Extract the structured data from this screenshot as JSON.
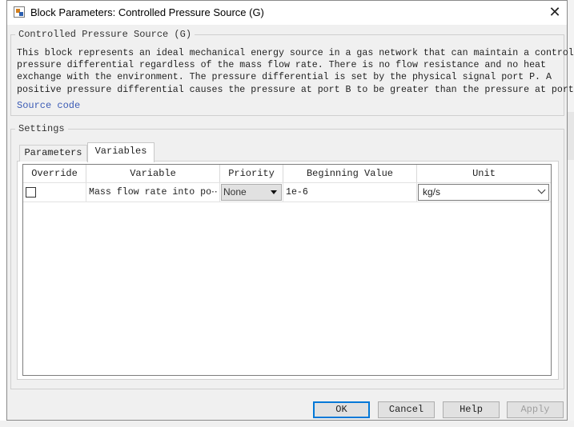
{
  "window": {
    "title": "Block Parameters: Controlled Pressure Source (G)",
    "close_symbol": "✕"
  },
  "block": {
    "group_title": "Controlled Pressure Source (G)",
    "description_lines": [
      "This block represents an ideal mechanical energy source in a gas network that can maintain a controlled",
      "pressure differential regardless of the mass flow rate. There is no flow resistance and no heat",
      "exchange with the environment. The pressure differential is set by the physical signal port P. A",
      "positive pressure differential causes the pressure at port B to be greater than the pressure at port A."
    ],
    "source_code_link": "Source code"
  },
  "settings": {
    "group_title": "Settings",
    "tabs": [
      {
        "label": "Parameters",
        "selected": false
      },
      {
        "label": "Variables",
        "selected": true
      }
    ]
  },
  "variables_table": {
    "columns": [
      "Override",
      "Variable",
      "Priority",
      "Beginning Value",
      "Unit"
    ],
    "rows": [
      {
        "override": false,
        "variable": "Mass flow rate into po⋯",
        "priority": "None",
        "beginning_value": "1e-6",
        "unit": "kg/s"
      }
    ]
  },
  "buttons": {
    "ok": "OK",
    "cancel": "Cancel",
    "help": "Help",
    "apply": "Apply"
  },
  "icons": {
    "title": "block-parameters-icon",
    "close": "close-icon",
    "priority_dropdown": "caret-down-icon",
    "unit_dropdown": "chevron-down-icon"
  },
  "colors": {
    "link": "#3b5bb5",
    "ok_focus_border": "#0078d7",
    "dialog_background": "#f0f0f0"
  }
}
